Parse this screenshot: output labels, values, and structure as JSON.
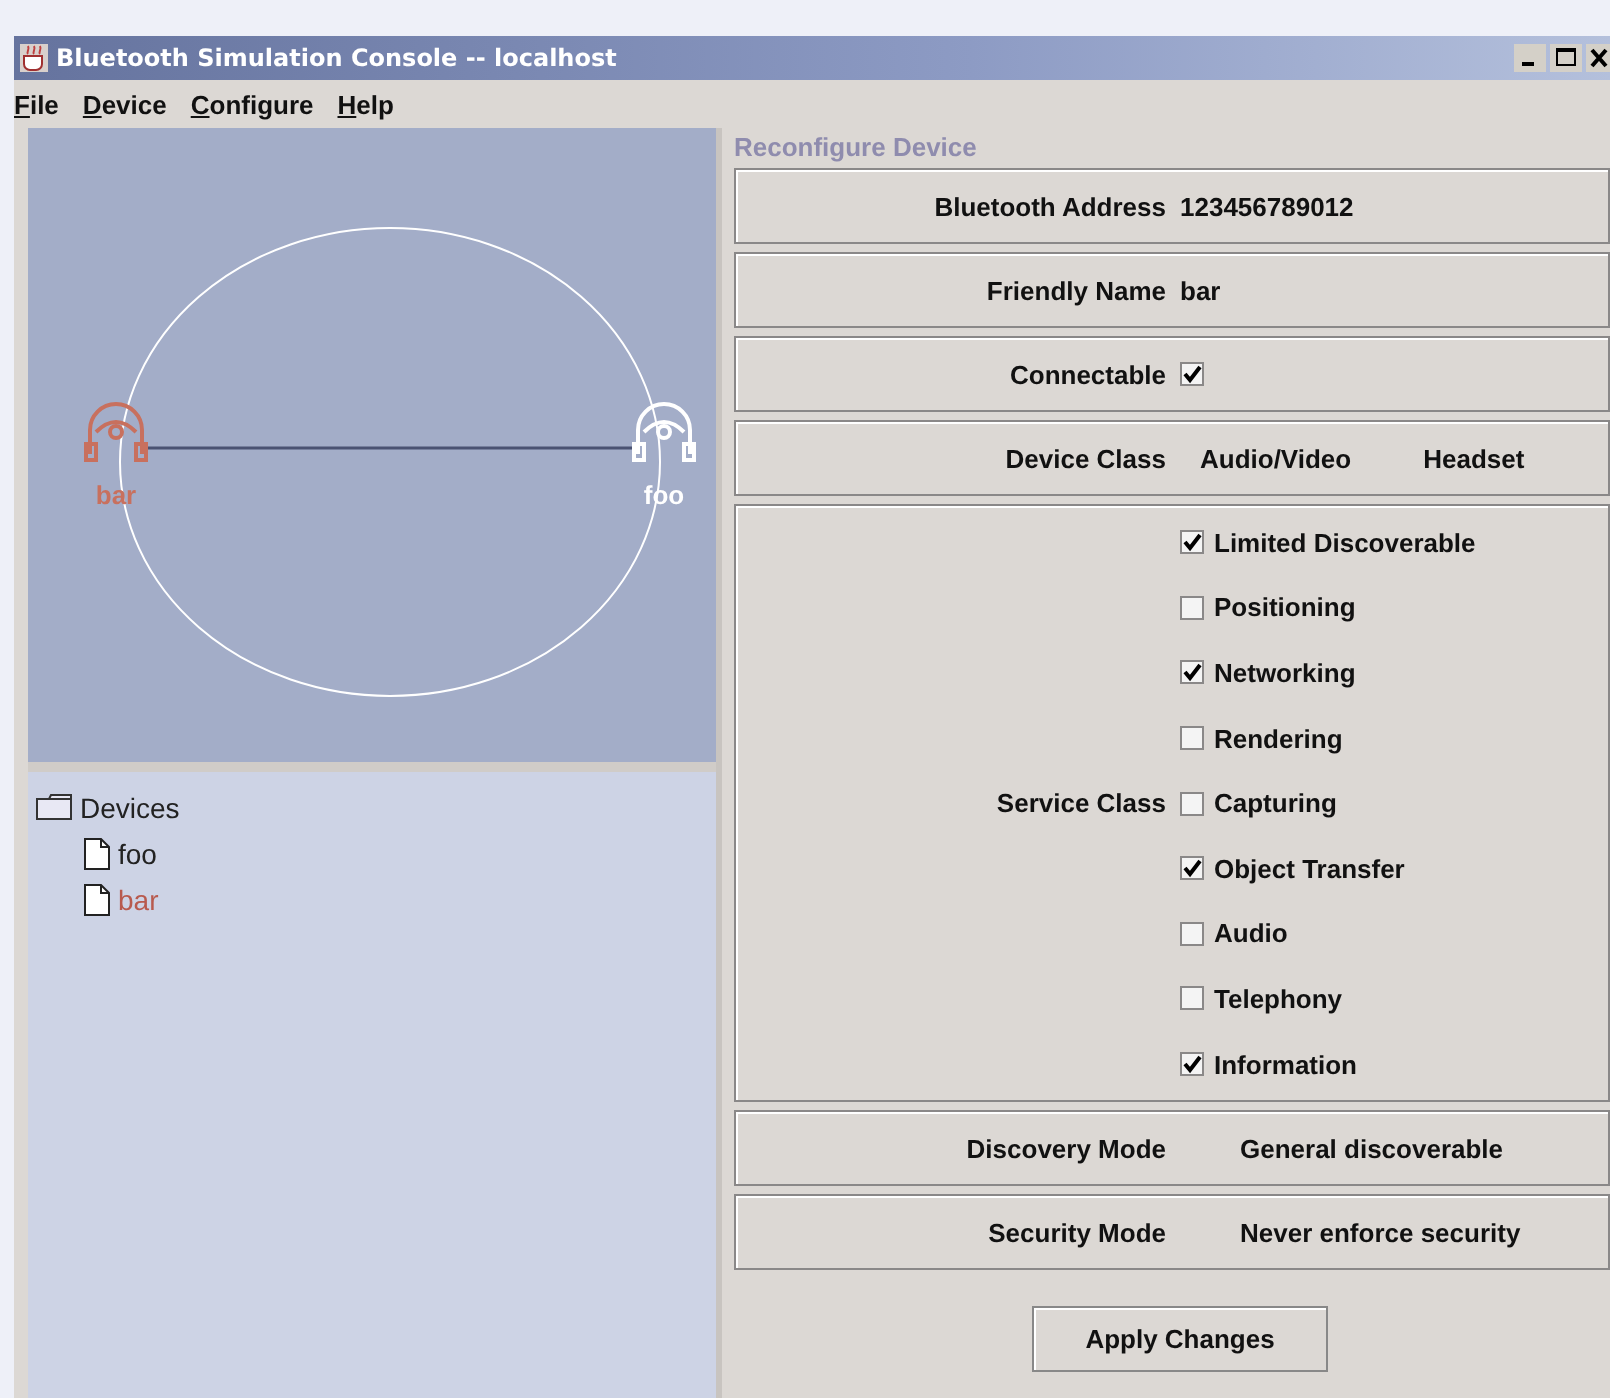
{
  "window": {
    "title": "Bluetooth Simulation Console -- localhost"
  },
  "menu": [
    "File",
    "Device",
    "Configure",
    "Help"
  ],
  "canvas": {
    "nodes": [
      {
        "label": "bar",
        "selected": true
      },
      {
        "label": "foo",
        "selected": false
      }
    ]
  },
  "tree": {
    "label": "Devices",
    "children": [
      {
        "label": "foo",
        "selected": false
      },
      {
        "label": "bar",
        "selected": true
      }
    ]
  },
  "form": {
    "title": "Reconfigure Device",
    "rows": [
      {
        "kind": "text",
        "label": "Bluetooth Address",
        "value": "123456789012"
      },
      {
        "kind": "text",
        "label": "Friendly Name",
        "value": "bar"
      },
      {
        "kind": "check",
        "label": "Connectable",
        "checked": true
      },
      {
        "kind": "pair",
        "label": "Device Class",
        "values": [
          "Audio/Video",
          "Headset"
        ]
      },
      {
        "kind": "checklist",
        "label": "Service Class",
        "options": [
          {
            "label": "Limited Discoverable",
            "checked": true
          },
          {
            "label": "Positioning",
            "checked": false
          },
          {
            "label": "Networking",
            "checked": true
          },
          {
            "label": "Rendering",
            "checked": false
          },
          {
            "label": "Capturing",
            "checked": false
          },
          {
            "label": "Object Transfer",
            "checked": true
          },
          {
            "label": "Audio",
            "checked": false
          },
          {
            "label": "Telephony",
            "checked": false
          },
          {
            "label": "Information",
            "checked": true
          }
        ]
      },
      {
        "kind": "mode",
        "label": "Discovery Mode",
        "value": "General discoverable"
      },
      {
        "kind": "mode",
        "label": "Security Mode",
        "value": "Never enforce security"
      }
    ],
    "button": "Apply Changes"
  }
}
